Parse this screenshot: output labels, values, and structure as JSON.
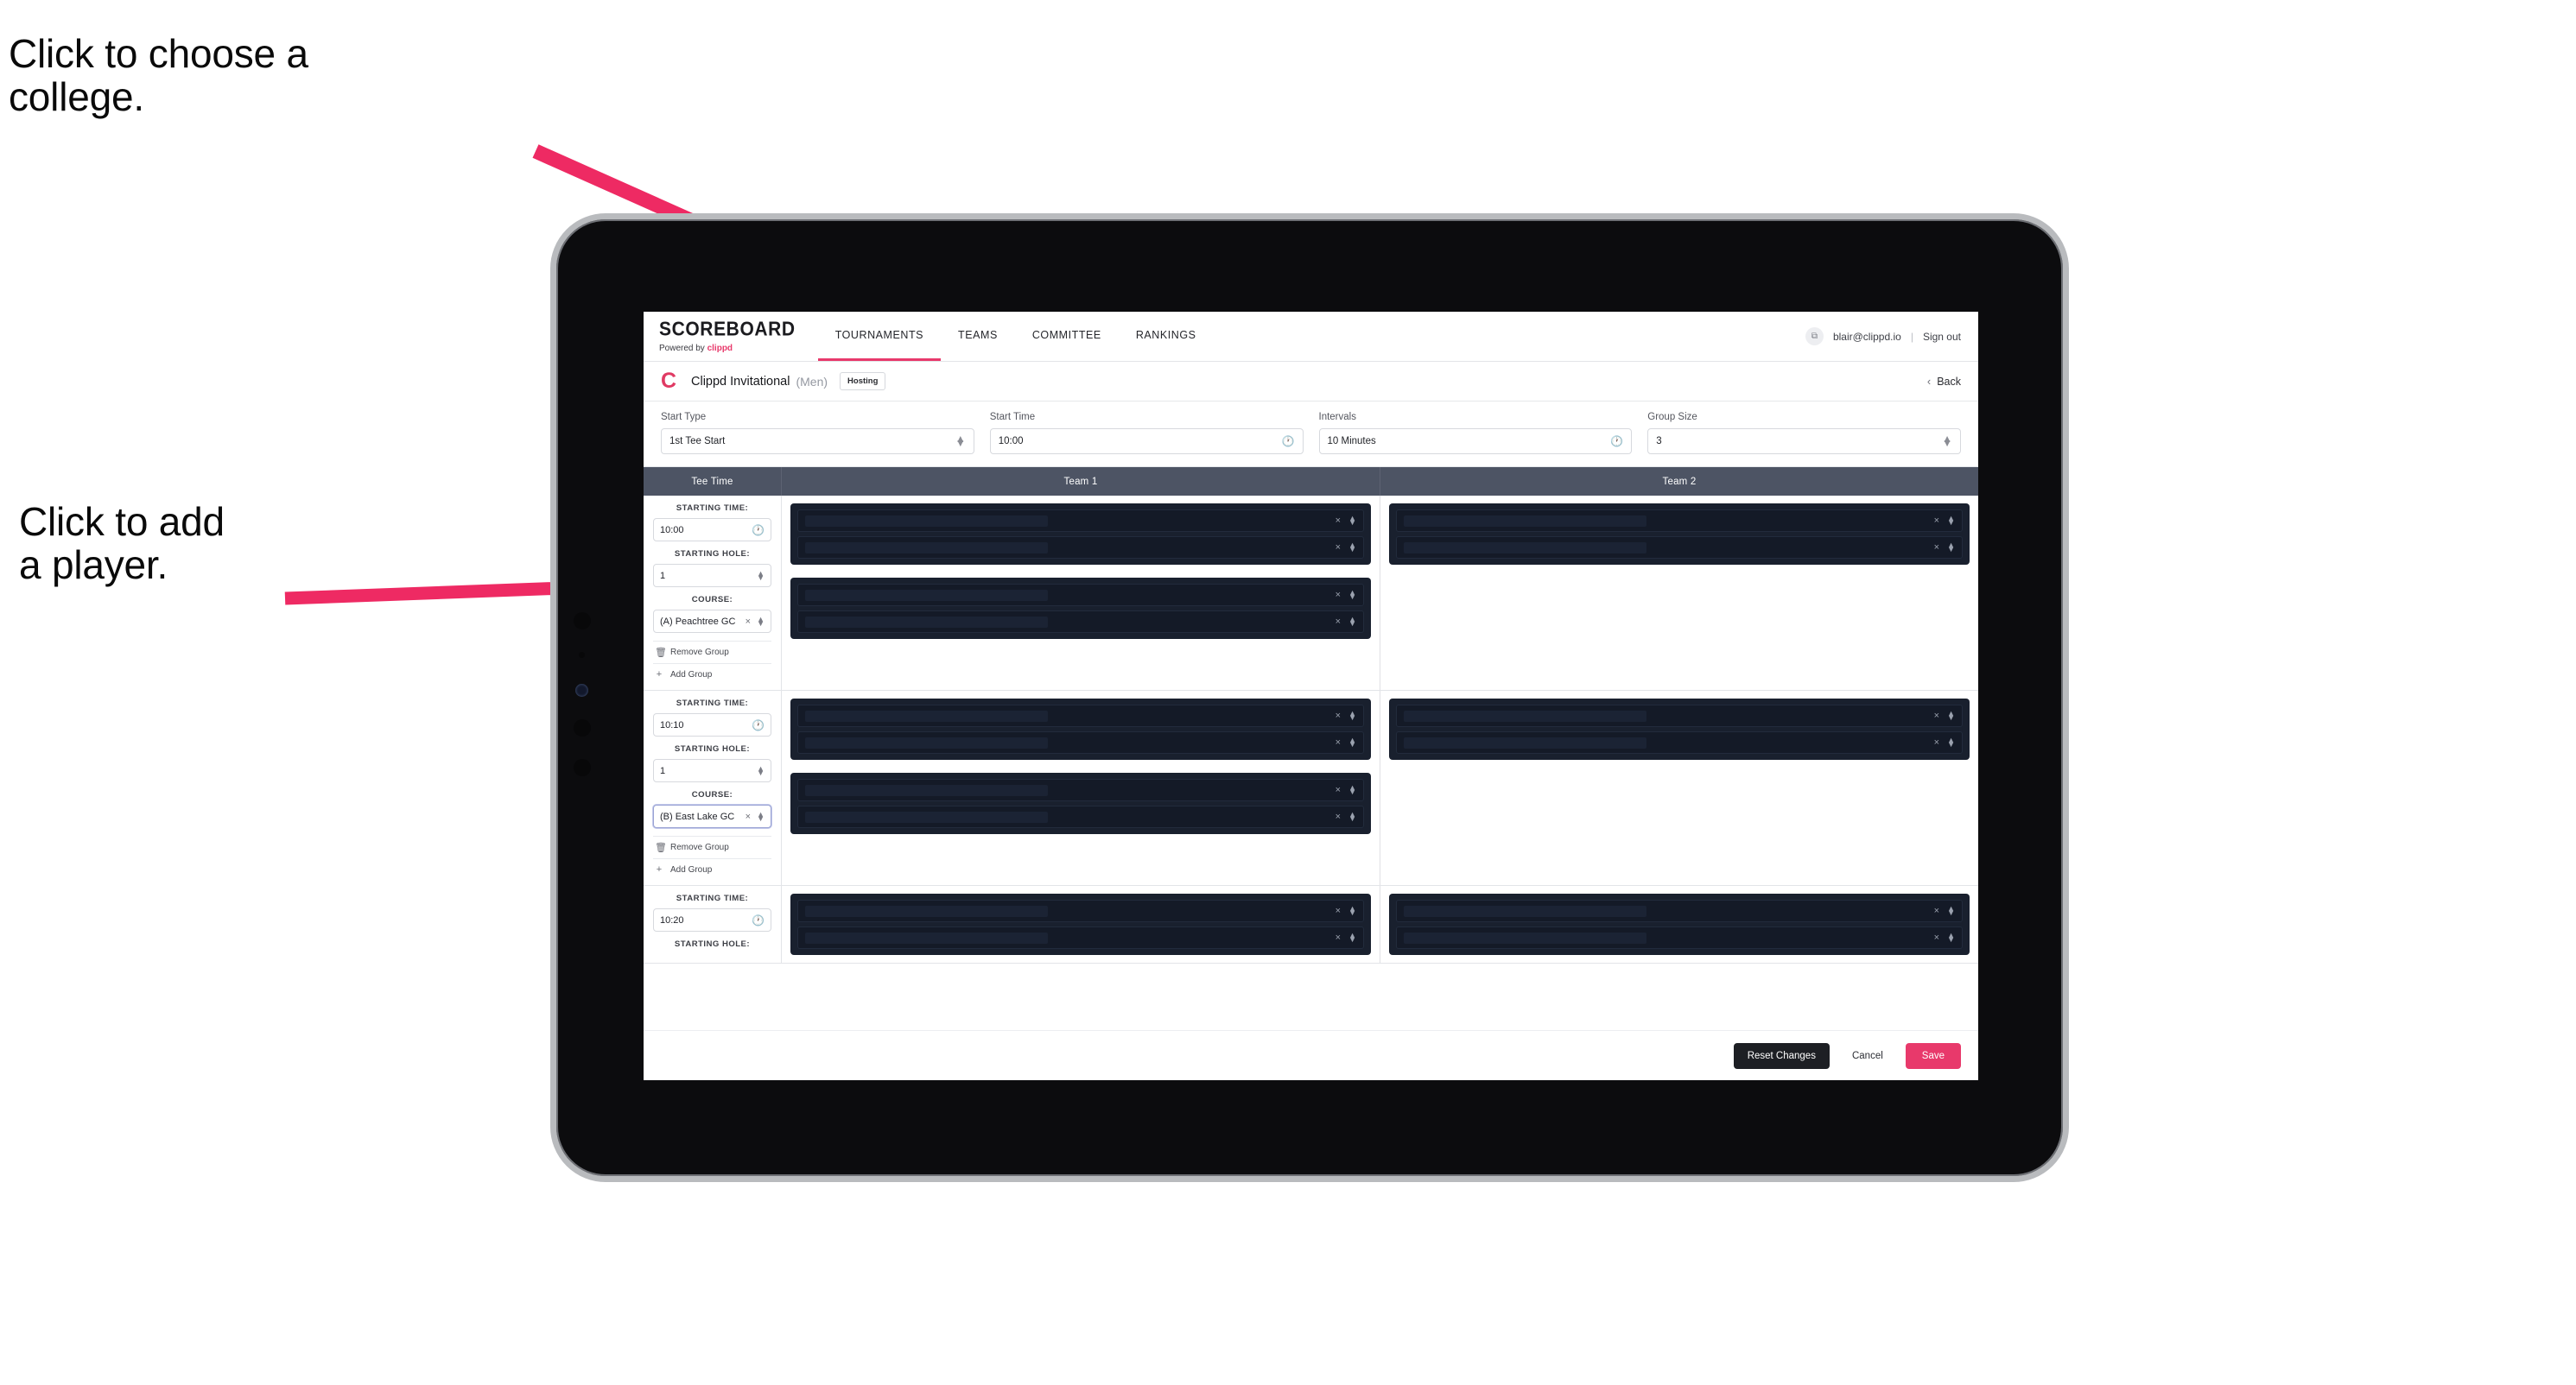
{
  "annotations": {
    "college": "Click to choose a\ncollege.",
    "player": "Click to add\na player."
  },
  "nav": {
    "brand_name": "SCOREBOARD",
    "brand_powered_prefix": "Powered by ",
    "brand_powered_name": "clippd",
    "items": [
      {
        "label": "TOURNAMENTS",
        "active": true
      },
      {
        "label": "TEAMS",
        "active": false
      },
      {
        "label": "COMMITTEE",
        "active": false
      },
      {
        "label": "RANKINGS",
        "active": false
      }
    ],
    "account_email": "blair@clippd.io",
    "separator": "|",
    "sign_out": "Sign out",
    "avatar_glyph": "⧉"
  },
  "title_bar": {
    "logo_letter": "C",
    "tournament": "Clippd Invitational",
    "gender": "(Men)",
    "badge": "Hosting",
    "back_label": "Back",
    "back_chevron": "‹"
  },
  "filters": [
    {
      "label": "Start Type",
      "value": "1st Tee Start",
      "control": "select"
    },
    {
      "label": "Start Time",
      "value": "10:00",
      "control": "time"
    },
    {
      "label": "Intervals",
      "value": "10 Minutes",
      "control": "time"
    },
    {
      "label": "Group Size",
      "value": "3",
      "control": "select"
    }
  ],
  "table": {
    "headers": {
      "tee_time": "Tee Time",
      "team1": "Team 1",
      "team2": "Team 2"
    },
    "field_labels": {
      "starting_time": "STARTING TIME:",
      "starting_hole": "STARTING HOLE:",
      "course": "COURSE:"
    },
    "group_actions": {
      "remove": "Remove Group",
      "add": "Add Group"
    },
    "rows": [
      {
        "starting_time": "10:00",
        "starting_hole": "1",
        "course": "(A) Peachtree GC",
        "course_focused": false,
        "team1_groups": [
          {
            "slots": 2
          },
          {
            "slots": 2
          }
        ],
        "team2_groups": [
          {
            "slots": 2
          }
        ]
      },
      {
        "starting_time": "10:10",
        "starting_hole": "1",
        "course": "(B) East Lake GC",
        "course_focused": true,
        "team1_groups": [
          {
            "slots": 2
          },
          {
            "slots": 2
          }
        ],
        "team2_groups": [
          {
            "slots": 2
          }
        ]
      },
      {
        "starting_time": "10:20",
        "starting_hole": "",
        "course": "",
        "course_focused": false,
        "team1_groups": [
          {
            "slots": 2
          }
        ],
        "team2_groups": [
          {
            "slots": 2
          }
        ]
      }
    ]
  },
  "footer": {
    "reset": "Reset Changes",
    "cancel": "Cancel",
    "save": "Save"
  },
  "colors": {
    "accent_pink": "#e8396b",
    "header_slate": "#4d5464",
    "slot_dark": "#141a27",
    "group_dark": "#19202e",
    "arrow_pink": "#ee2a63"
  }
}
